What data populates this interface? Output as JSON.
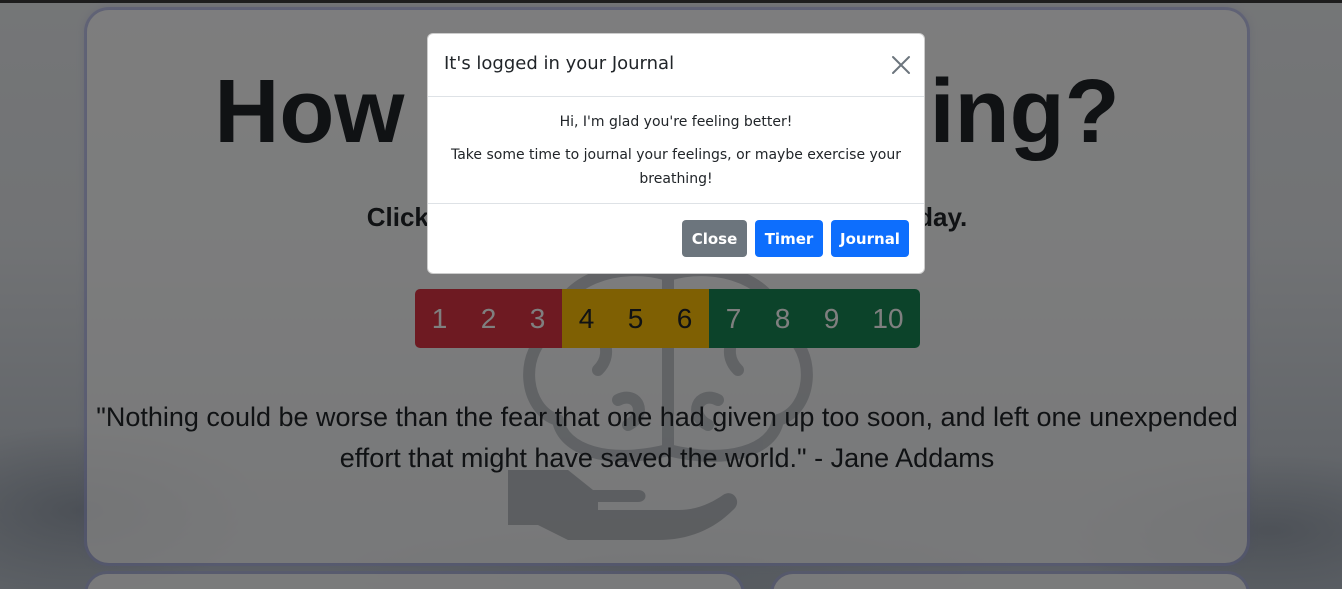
{
  "page": {
    "title": "How are you feeling?",
    "subtitle": "Click a number below to rate how you feel today.",
    "scale": [
      {
        "label": "1",
        "color": "#dc3545"
      },
      {
        "label": "2",
        "color": "#dc3545"
      },
      {
        "label": "3",
        "color": "#dc3545"
      },
      {
        "label": "4",
        "color": "#ffc107"
      },
      {
        "label": "5",
        "color": "#ffc107"
      },
      {
        "label": "6",
        "color": "#ffc107"
      },
      {
        "label": "7",
        "color": "#198754"
      },
      {
        "label": "8",
        "color": "#198754"
      },
      {
        "label": "9",
        "color": "#198754"
      },
      {
        "label": "10",
        "color": "#198754"
      }
    ],
    "quote": "\"Nothing could be worse than the fear that one had given up too soon, and left one unexpended effort that might have saved the world.\" - Jane Addams",
    "background_icon": "brain-hand-icon"
  },
  "modal": {
    "title": "It's logged in your Journal",
    "close_icon": "close-icon",
    "body_line1": "Hi, I'm glad you're feeling better!",
    "body_line2": "Take some time to journal your feelings, or maybe exercise your breathing!",
    "buttons": {
      "close": "Close",
      "timer": "Timer",
      "journal": "Journal"
    }
  },
  "colors": {
    "primary": "#0d6efd",
    "secondary": "#6c757d",
    "danger": "#dc3545",
    "warning": "#ffc107",
    "success": "#198754"
  }
}
